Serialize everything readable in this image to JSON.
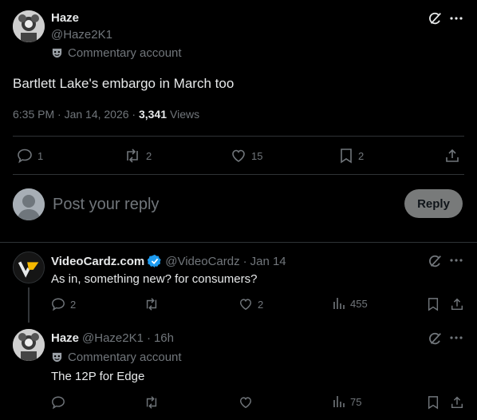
{
  "main_post": {
    "display_name": "Haze",
    "handle": "@Haze2K1",
    "badge_label": "Commentary account",
    "text": "Bartlett Lake's embargo in March too",
    "timestamp": "6:35 PM · Jan 14, 2026 · ",
    "views_count": "3,341",
    "views_label": "Views",
    "replies": "1",
    "reposts": "2",
    "likes": "15",
    "bookmarks": "2"
  },
  "composer": {
    "placeholder": "Post your reply",
    "reply_button": "Reply"
  },
  "replies": [
    {
      "display_name": "VideoCardz.com",
      "handle": "@VideoCardz",
      "date": "Jan 14",
      "text": "As in, something new? for consumers?",
      "replies": "2",
      "reposts": "",
      "likes": "2",
      "views": "455"
    },
    {
      "display_name": "Haze",
      "handle": "@Haze2K1",
      "date": "16h",
      "badge_label": "Commentary account",
      "text": "The 12P for Edge",
      "replies": "",
      "reposts": "",
      "likes": "",
      "views": "75"
    }
  ],
  "separator": "·",
  "colors": {
    "accent": "#1d9bf0",
    "muted": "#71767b",
    "border": "#2f3336",
    "verified": "#1d9bf0"
  }
}
